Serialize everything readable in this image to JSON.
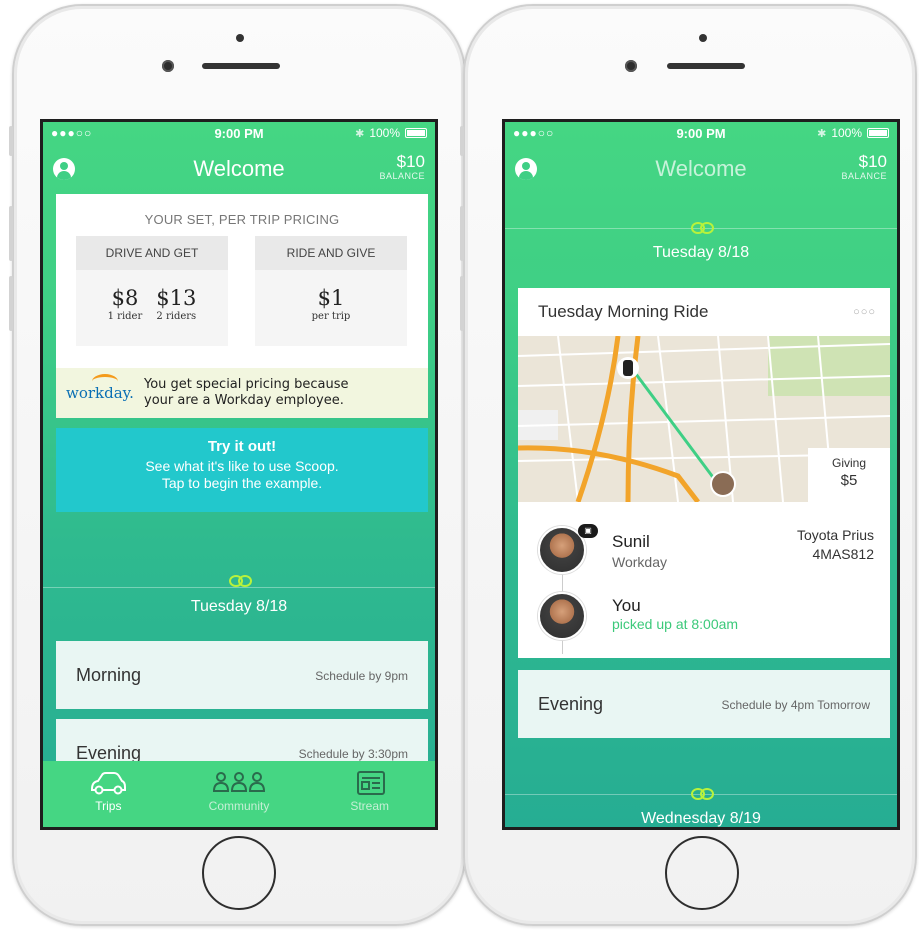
{
  "left": {
    "status": {
      "carrier": "●●●○○",
      "time": "9:00 PM",
      "battery": "100%"
    },
    "nav": {
      "title": "Welcome",
      "balance_amount": "$10",
      "balance_label": "BALANCE"
    },
    "pricing": {
      "heading": "YOUR SET, PER TRIP PRICING",
      "drive": {
        "header": "DRIVE AND GET",
        "items": [
          {
            "value": "$8",
            "label": "1 rider"
          },
          {
            "value": "$13",
            "label": "2 riders"
          }
        ]
      },
      "ride": {
        "header": "RIDE AND GIVE",
        "items": [
          {
            "value": "$1",
            "label": "per trip"
          }
        ]
      }
    },
    "workday": {
      "logo": "workday.",
      "text_line1": "You get special pricing because",
      "text_line2": "your are a Workday employee."
    },
    "try": {
      "title": "Try it out!",
      "line1": "See what it's like to use Scoop.",
      "line2": "Tap to begin the example."
    },
    "day": "Tuesday 8/18",
    "slots": [
      {
        "name": "Morning",
        "schedule": "Schedule by 9pm"
      },
      {
        "name": "Evening",
        "schedule": "Schedule by 3:30pm"
      }
    ],
    "tabs": [
      {
        "label": "Trips",
        "icon": "car-icon"
      },
      {
        "label": "Community",
        "icon": "community-icon"
      },
      {
        "label": "Stream",
        "icon": "stream-icon"
      }
    ]
  },
  "right": {
    "status": {
      "carrier": "●●●○○",
      "time": "9:00 PM",
      "battery": "100%"
    },
    "nav": {
      "title": "Welcome",
      "balance_amount": "$10",
      "balance_label": "BALANCE"
    },
    "day": "Tuesday 8/18",
    "trip": {
      "title": "Tuesday Morning Ride",
      "more": "○○○",
      "giving_label": "Giving",
      "giving_amount": "$5",
      "driver_name": "Sunil",
      "driver_company": "Workday",
      "car_model": "Toyota Prius",
      "car_plate": "4MAS812",
      "rider_name": "You",
      "rider_status": "picked up at 8:00am"
    },
    "evening": {
      "name": "Evening",
      "schedule": "Schedule by 4pm Tomorrow"
    },
    "next_day": "Wednesday 8/19"
  },
  "colors": {
    "brand_green": "#45d683",
    "teal": "#22c8cc",
    "accent_lime": "#b8f23c",
    "workday_blue": "#0a6fb4"
  }
}
